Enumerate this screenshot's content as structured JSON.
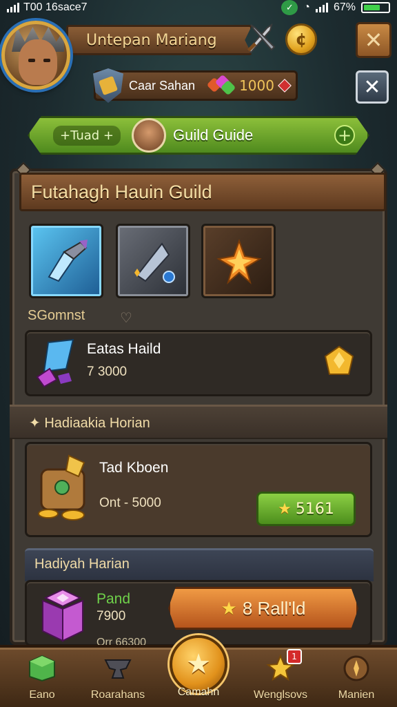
{
  "status_bar": {
    "time": "T00 16sace7",
    "battery": "67%"
  },
  "header": {
    "player_name": "Untepan Mariang",
    "coin_icon": "coin-icon",
    "sub_label": "Caar Sahan",
    "gem_value": "1000"
  },
  "guide_banner": {
    "tag": "+Tuad +",
    "title": "Guild Guide"
  },
  "panel": {
    "title": "Futahagh Hauin Guild",
    "section_1": "SGomnst",
    "card_1": {
      "title": "Eatas Haild",
      "subtitle": "7 3000"
    },
    "section_2": "Hadiaakia Horian",
    "card_2": {
      "title": "Tad Kboen",
      "subtitle": "Ont - 5000",
      "button": "5161"
    },
    "section_3": "Hadiyah Harian",
    "card_3": {
      "title": "Pand",
      "subtitle": "7900",
      "extra": "Orr 66300",
      "button": "8 Rall'ld"
    }
  },
  "bottom_nav": {
    "items": [
      {
        "label": "Eano",
        "icon": "green-cube-icon"
      },
      {
        "label": "Roarahans",
        "icon": "anvil-icon"
      },
      {
        "label": "Camahn",
        "icon": "star-icon"
      },
      {
        "label": "Wenglsovs",
        "icon": "star-chest-icon",
        "badge": "1"
      },
      {
        "label": "Manien",
        "icon": "compass-icon"
      }
    ]
  },
  "colors": {
    "accent_gold": "#e1a21f",
    "button_green": "#6aae2c",
    "button_orange": "#d9772c",
    "panel_bg": "#3f3a34"
  }
}
